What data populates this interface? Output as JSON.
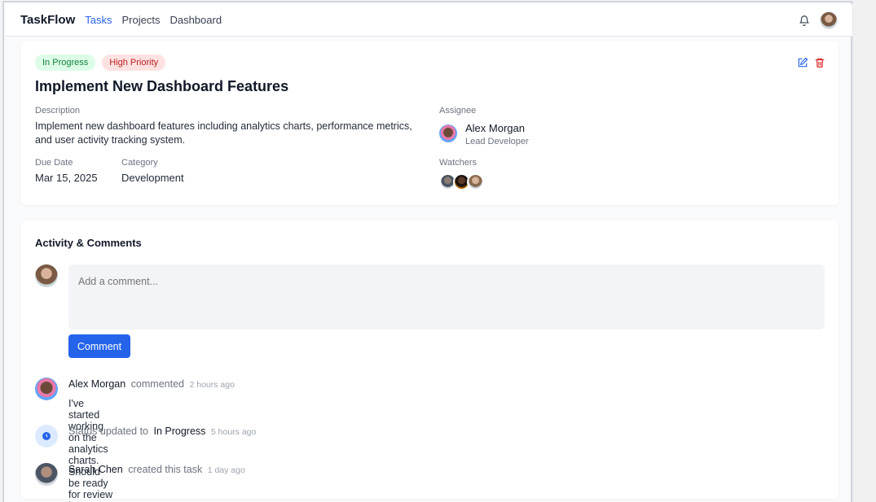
{
  "nav": {
    "brand": "TaskFlow",
    "links": [
      "Tasks",
      "Projects",
      "Dashboard"
    ],
    "active_link": "Tasks",
    "icons": [
      "bell-icon",
      "user-avatar"
    ]
  },
  "task": {
    "status_badge": "In Progress",
    "priority_badge": "High Priority",
    "title": "Implement New Dashboard Features",
    "description_label": "Description",
    "description": "Implement new dashboard features including analytics charts, performance metrics, and user activity tracking system.",
    "due_date_label": "Due Date",
    "due_date": "Mar 15, 2025",
    "category_label": "Category",
    "category": "Development",
    "assignee_label": "Assignee",
    "assignee_name": "Alex Morgan",
    "assignee_role": "Lead Developer",
    "watchers_label": "Watchers",
    "actions": [
      "edit-icon",
      "trash-icon"
    ]
  },
  "activity": {
    "title": "Activity & Comments",
    "comment_placeholder": "Add a comment...",
    "comment_button": "Comment",
    "items": [
      {
        "who": "Alex Morgan",
        "verb": "commented",
        "time": "2 hours ago",
        "text": "I've started working on the analytics charts. Should be ready for review by tomorrow."
      },
      {
        "prefix": "Status updated to",
        "status": "In Progress",
        "time": "5 hours ago"
      },
      {
        "who": "Sarah Chen",
        "verb": "created this task",
        "time": "1 day ago"
      }
    ]
  },
  "colors": {
    "accent": "#2563eb",
    "status_bg": "#dcfce7",
    "status_fg": "#15803d",
    "priority_bg": "#fee2e2",
    "priority_fg": "#b91c1c",
    "delete": "#dc2626"
  }
}
